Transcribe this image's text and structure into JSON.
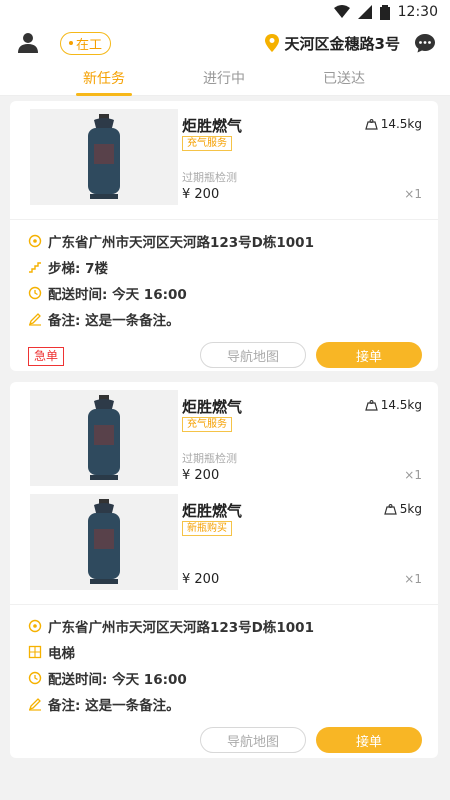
{
  "status_bar": {
    "time": "12:30"
  },
  "header": {
    "status_label": "在工",
    "location": "天河区金穗路3号"
  },
  "tabs": [
    {
      "label": "新任务",
      "active": true
    },
    {
      "label": "进行中",
      "active": false
    },
    {
      "label": "已送达",
      "active": false
    }
  ],
  "orders": [
    {
      "items": [
        {
          "name": "炬胜燃气",
          "tag": "充气服务",
          "weight": "14.5kg",
          "note": "过期瓶检测",
          "price": "¥ 200",
          "qty": "×1"
        }
      ],
      "address": "广东省广州市天河区天河路123号D栋1001",
      "stairs": "步梯: 7楼",
      "delivery_time": "配送时间: 今天 16:00",
      "remark": "备注: 这是一条备注。",
      "urgent_label": "急单",
      "nav_label": "导航地图",
      "accept_label": "接单"
    },
    {
      "items": [
        {
          "name": "炬胜燃气",
          "tag": "充气服务",
          "weight": "14.5kg",
          "note": "过期瓶检测",
          "price": "¥ 200",
          "qty": "×1"
        },
        {
          "name": "炬胜燃气",
          "tag": "新瓶购买",
          "weight": "5kg",
          "note": "",
          "price": "¥ 200",
          "qty": "×1"
        }
      ],
      "address": "广东省广州市天河区天河路123号D栋1001",
      "stairs": "电梯",
      "delivery_time": "配送时间: 今天 16:00",
      "remark": "备注: 这是一条备注。",
      "nav_label": "导航地图",
      "accept_label": "接单"
    }
  ],
  "colors": {
    "accent": "#f8b625",
    "urgent": "#e33333",
    "tab_active": "#f5a000"
  }
}
